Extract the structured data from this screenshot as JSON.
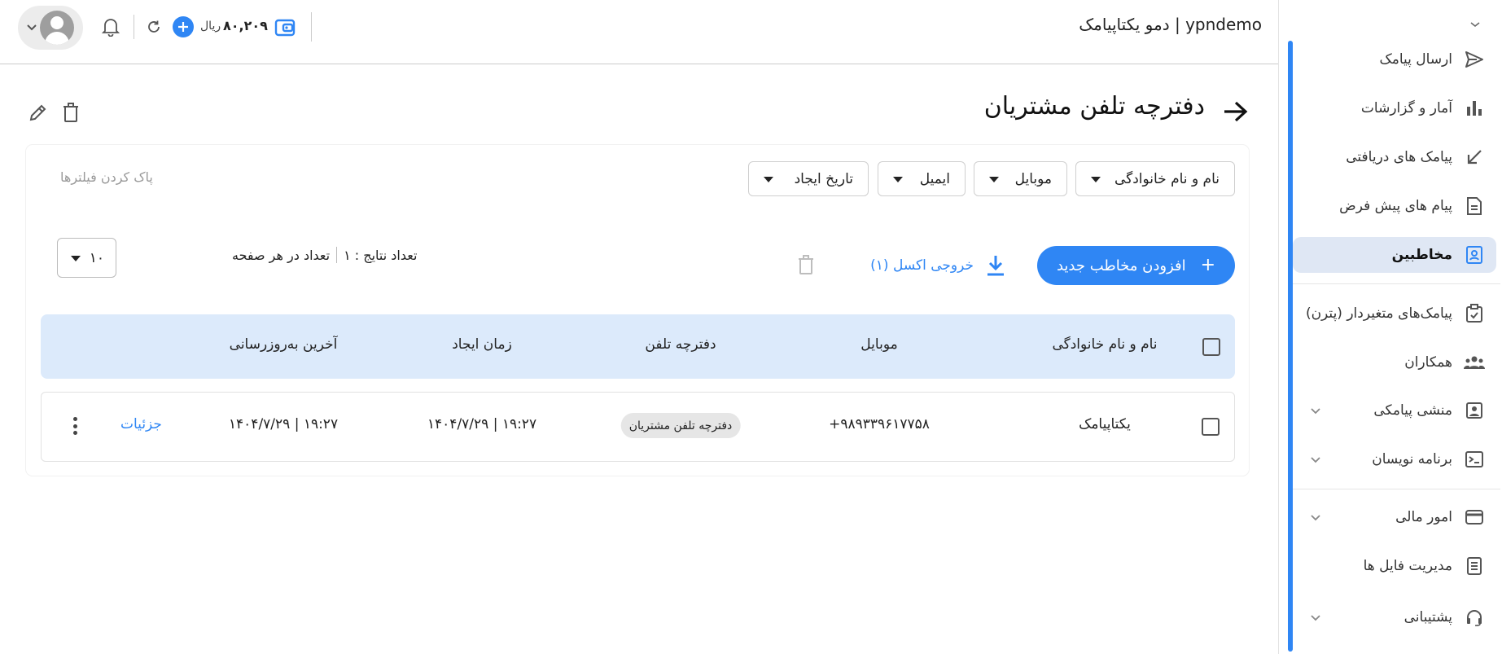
{
  "header": {
    "app_title": "دمو یکتاپیامک | ypndemo",
    "balance": "۸۰,۲۰۹",
    "currency": "ریال"
  },
  "sidebar": {
    "items": [
      {
        "label": "ارسال پیامک",
        "icon": "send-icon"
      },
      {
        "label": "آمار و گزارشات",
        "icon": "bar-chart-icon"
      },
      {
        "label": "پیامک های دریافتی",
        "icon": "arrow-incoming-icon"
      },
      {
        "label": "پیام های پیش فرض",
        "icon": "document-icon"
      },
      {
        "label": "مخاطبین",
        "icon": "contacts-icon",
        "active": true
      },
      {
        "label": "پیامک‌های متغیردار (پترن)",
        "icon": "clipboard-check-icon"
      },
      {
        "label": "همکاران",
        "icon": "group-icon"
      },
      {
        "label": "منشی پیامکی",
        "icon": "assistant-icon",
        "expandable": true
      },
      {
        "label": "برنامه نویسان",
        "icon": "terminal-icon",
        "expandable": true
      },
      {
        "label": "امور مالی",
        "icon": "wallet-icon",
        "expandable": true
      },
      {
        "label": "مدیریت فایل ها",
        "icon": "file-list-icon"
      },
      {
        "label": "پشتیبانی",
        "icon": "support-icon",
        "expandable": true
      }
    ]
  },
  "page": {
    "title": "دفترچه تلفن مشتریان"
  },
  "filters": {
    "chips": [
      "نام و نام خانوادگی",
      "موبایل",
      "ایمیل",
      "تاریخ ایجاد"
    ],
    "clear_label": "پاک کردن فیلترها"
  },
  "toolbar": {
    "add_label": "افزودن مخاطب جدید",
    "excel_label": "خروجی اکسل (۱)",
    "results_label": "تعداد نتایج : ۱",
    "per_page_label": "تعداد در هر صفحه",
    "per_page_value": "۱۰"
  },
  "table": {
    "headers": [
      "نام و نام خانوادگی",
      "موبایل",
      "دفترچه تلفن",
      "زمان ایجاد",
      "آخرین به‌روزرسانی"
    ],
    "rows": [
      {
        "name": "یکتاپیامک",
        "mobile": "+۹۸۹۳۳۹۶۱۷۷۵۸",
        "phonebook": "دفترچه تلفن مشتریان",
        "created": "۱۴۰۴/۷/۲۹ | ۱۹:۲۷",
        "updated": "۱۴۰۴/۷/۲۹ | ۱۹:۲۷",
        "details": "جزئیات"
      }
    ]
  },
  "colors": {
    "accent": "#2f86f4",
    "header_row": "#dceafb",
    "active_nav": "#dfe7f4"
  }
}
